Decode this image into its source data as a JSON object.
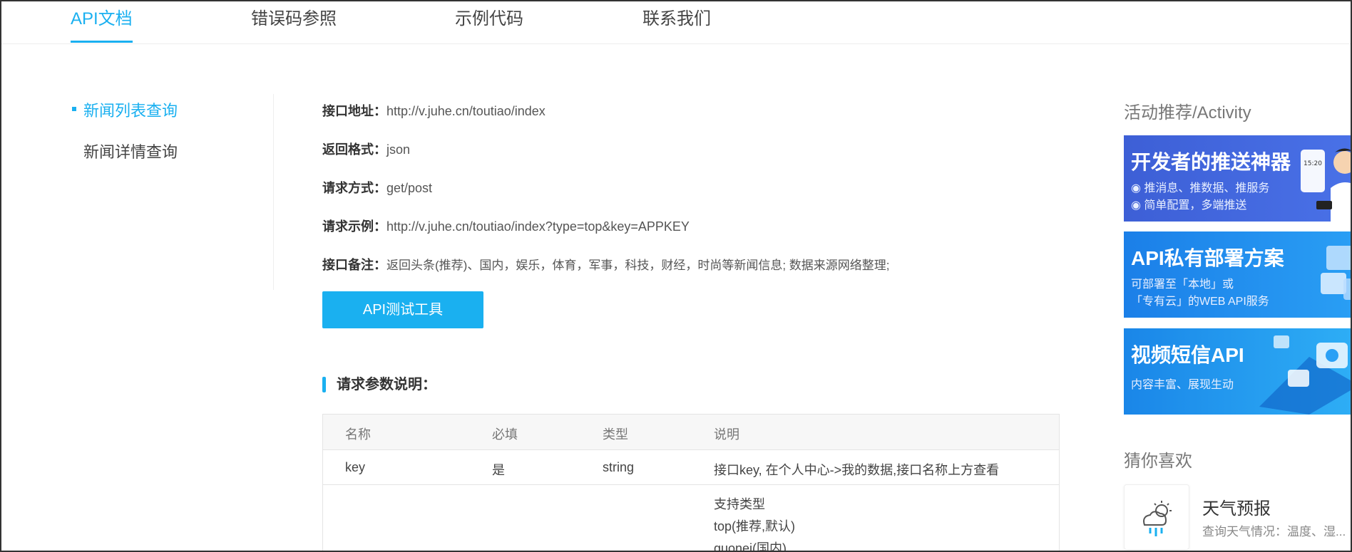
{
  "tabs": [
    {
      "label": "API文档",
      "active": true
    },
    {
      "label": "错误码参照",
      "active": false
    },
    {
      "label": "示例代码",
      "active": false
    },
    {
      "label": "联系我们",
      "active": false
    }
  ],
  "sidebar": {
    "items": [
      {
        "label": "新闻列表查询",
        "active": true
      },
      {
        "label": "新闻详情查询",
        "active": false
      }
    ]
  },
  "api_info": [
    {
      "key": "接口地址：",
      "value": "http://v.juhe.cn/toutiao/index"
    },
    {
      "key": "返回格式：",
      "value": "json"
    },
    {
      "key": "请求方式：",
      "value": "get/post"
    },
    {
      "key": "请求示例：",
      "value": "http://v.juhe.cn/toutiao/index?type=top&key=APPKEY"
    },
    {
      "key": "接口备注：",
      "value": "返回头条(推荐)、国内，娱乐，体育，军事，科技，财经，时尚等新闻信息; 数据来源网络整理;"
    }
  ],
  "test_button_label": "API测试工具",
  "params_section": {
    "title": "请求参数说明：",
    "headers": [
      "名称",
      "必填",
      "类型",
      "说明"
    ],
    "rows": [
      {
        "name": "key",
        "required": "是",
        "type": "string",
        "desc": "接口key, 在个人中心->我的数据,接口名称上方查看"
      },
      {
        "name": "",
        "required": "",
        "type": "",
        "desc_lines": [
          "支持类型",
          "top(推荐,默认)",
          "guonei(国内)"
        ]
      }
    ]
  },
  "right": {
    "activity_title": "活动推荐/Activity",
    "banners": [
      {
        "title": "开发者的推送神器",
        "line1": "推消息、推数据、推服务",
        "line2": "简单配置，多端推送",
        "time": "15:20"
      },
      {
        "title": "API私有部署方案",
        "line1": "可部署至「本地」或",
        "line2": "「专有云」的WEB API服务"
      },
      {
        "title": "视频短信API",
        "line1": "内容丰富、展现生动"
      }
    ],
    "guess_title": "猜你喜欢",
    "fav": {
      "name": "天气预报",
      "desc": "查询天气情况：温度、湿..."
    }
  },
  "colors": {
    "accent": "#1ab0f0"
  }
}
